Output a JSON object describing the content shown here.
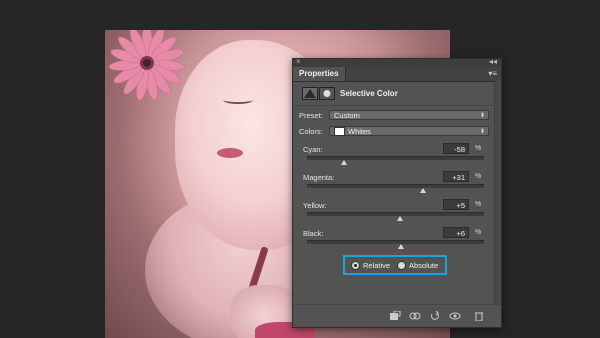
{
  "panel": {
    "tab_label": "Properties",
    "title": "Selective Color",
    "close_glyph": "×",
    "collapse_glyph": "◂◂",
    "menu_glyph": "▾≡"
  },
  "preset": {
    "label": "Preset:",
    "value": "Custom"
  },
  "colors": {
    "label": "Colors:",
    "value": "Whites"
  },
  "sliders": [
    {
      "label": "Cyan:",
      "value": "-58",
      "unit": "%",
      "level": 0.21
    },
    {
      "label": "Magenta:",
      "value": "+31",
      "unit": "%",
      "level": 0.655
    },
    {
      "label": "Yellow:",
      "value": "+5",
      "unit": "%",
      "level": 0.525
    },
    {
      "label": "Black:",
      "value": "+6",
      "unit": "%",
      "level": 0.53
    }
  ],
  "method": {
    "relative_label": "Relative",
    "absolute_label": "Absolute",
    "selected": "Relative"
  },
  "colors_theme": {
    "highlight": "#1aa3dc",
    "panel_bg": "#535353",
    "app_bg": "#262626"
  },
  "footer_icons": [
    "clip-to-layer-icon",
    "view-previous-icon",
    "reset-icon",
    "visibility-icon",
    "trash-icon"
  ]
}
